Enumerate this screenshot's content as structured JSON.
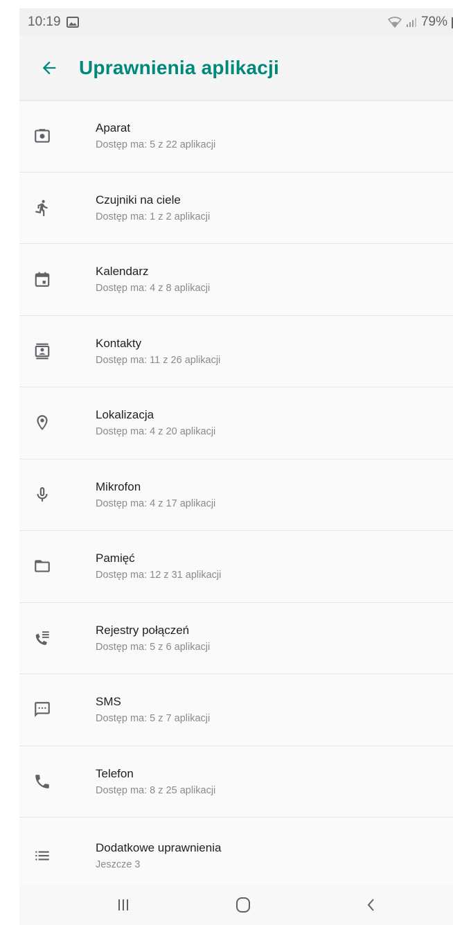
{
  "status_bar": {
    "time": "10:19",
    "battery": "79%"
  },
  "app_bar": {
    "title": "Uprawnienia aplikacji"
  },
  "permissions": [
    {
      "icon": "camera-icon",
      "title": "Aparat",
      "subtitle": "Dostęp ma: 5 z 22 aplikacji"
    },
    {
      "icon": "run-icon",
      "title": "Czujniki na ciele",
      "subtitle": "Dostęp ma: 1 z 2 aplikacji"
    },
    {
      "icon": "calendar-icon",
      "title": "Kalendarz",
      "subtitle": "Dostęp ma: 4 z 8 aplikacji"
    },
    {
      "icon": "contacts-icon",
      "title": "Kontakty",
      "subtitle": "Dostęp ma: 11 z 26 aplikacji"
    },
    {
      "icon": "location-icon",
      "title": "Lokalizacja",
      "subtitle": "Dostęp ma: 4 z 20 aplikacji"
    },
    {
      "icon": "microphone-icon",
      "title": "Mikrofon",
      "subtitle": "Dostęp ma: 4 z 17 aplikacji"
    },
    {
      "icon": "folder-icon",
      "title": "Pamięć",
      "subtitle": "Dostęp ma: 12 z 31 aplikacji"
    },
    {
      "icon": "call-log-icon",
      "title": "Rejestry połączeń",
      "subtitle": "Dostęp ma: 5 z 6 aplikacji"
    },
    {
      "icon": "sms-icon",
      "title": "SMS",
      "subtitle": "Dostęp ma: 5 z 7 aplikacji"
    },
    {
      "icon": "phone-icon",
      "title": "Telefon",
      "subtitle": "Dostęp ma: 8 z 25 aplikacji"
    },
    {
      "icon": "list-icon",
      "title": "Dodatkowe uprawnienia",
      "subtitle": "Jeszcze 3"
    }
  ],
  "colors": {
    "accent": "#00897b",
    "icon": "#5f6368"
  }
}
